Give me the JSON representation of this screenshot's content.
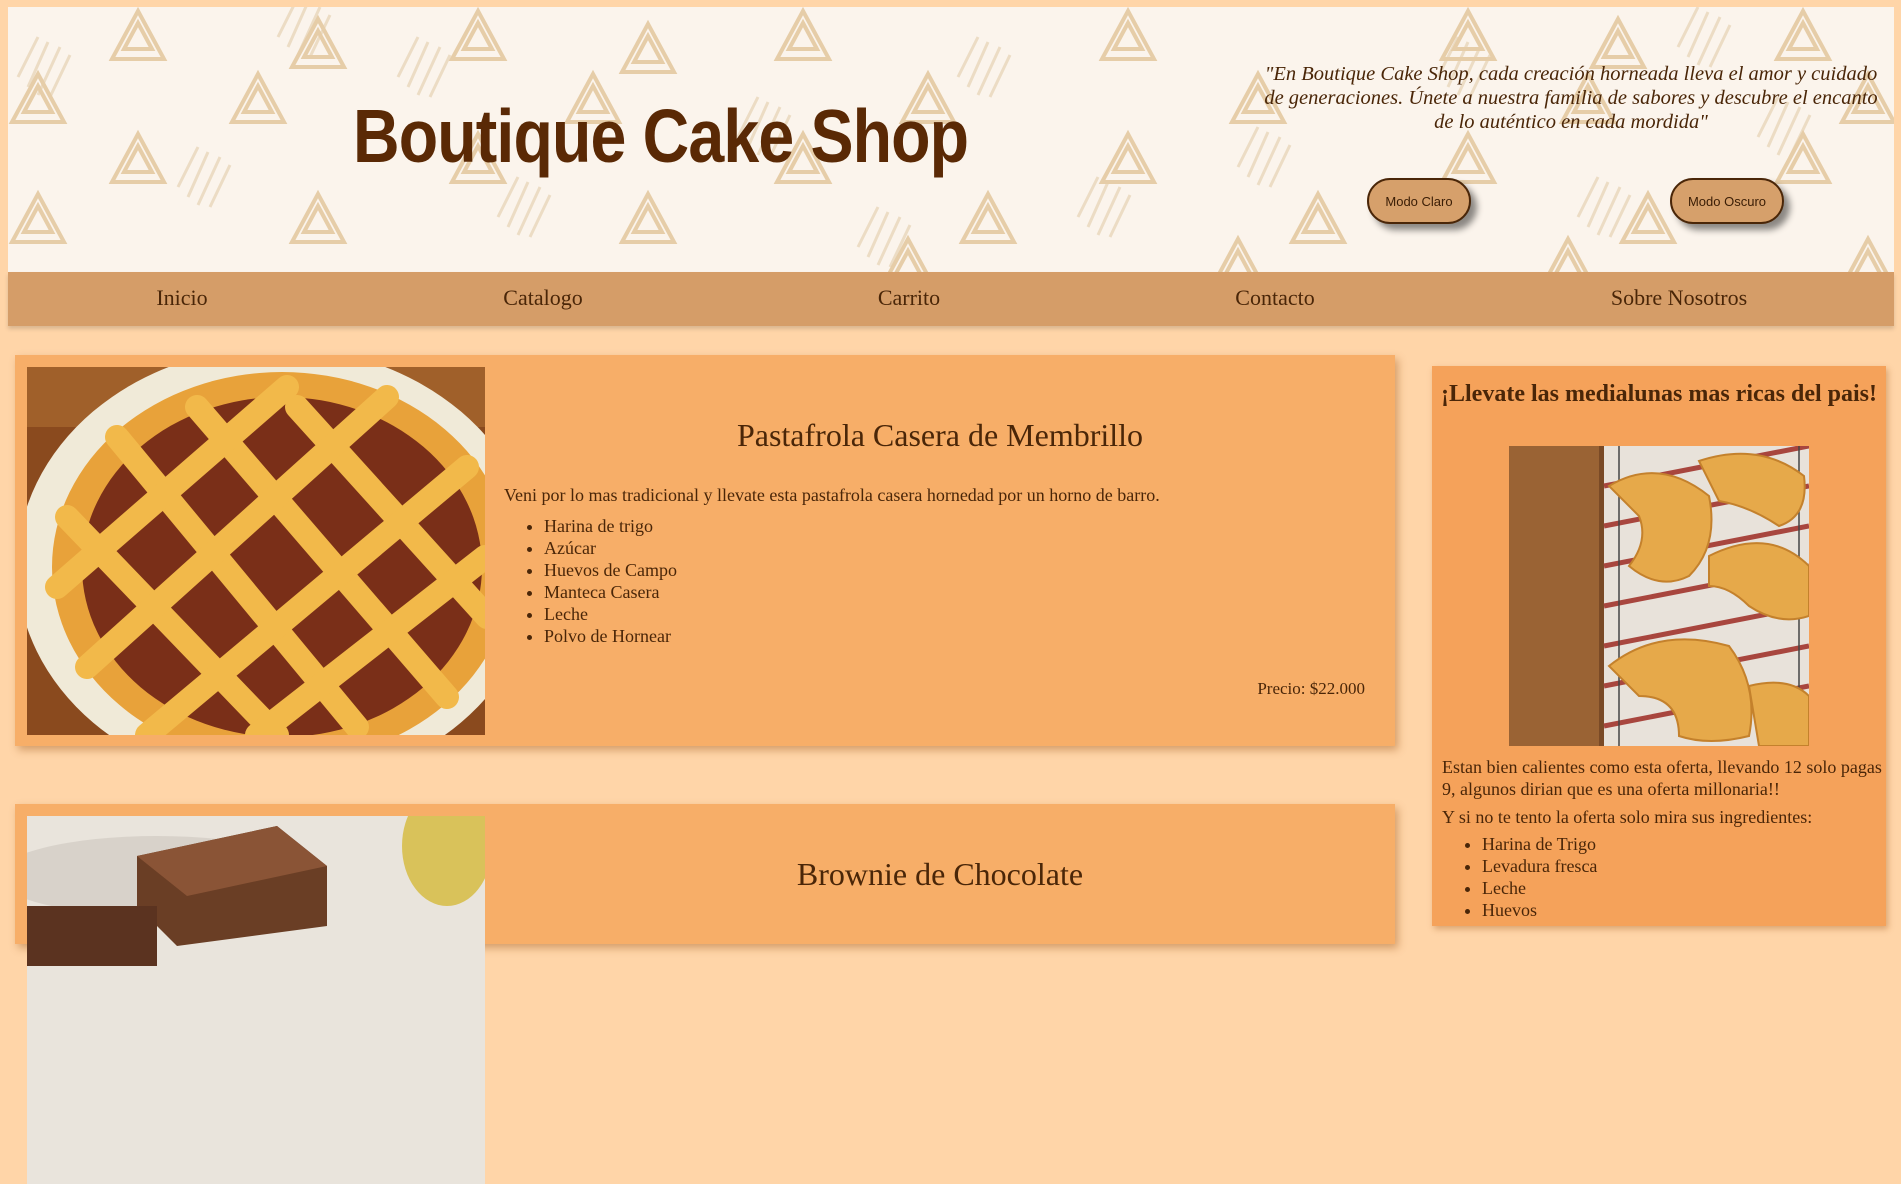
{
  "header": {
    "brand": "Boutique Cake Shop",
    "quote": "\"En Boutique Cake Shop, cada creación horneada lleva el amor y cuidado de generaciones. Únete a nuestra familia de sabores y descubre el encanto de lo auténtico en cada mordida\"",
    "btn_light": "Modo Claro",
    "btn_dark": "Modo Oscuro"
  },
  "nav": {
    "items": [
      {
        "label": "Inicio"
      },
      {
        "label": "Catalogo"
      },
      {
        "label": "Carrito"
      },
      {
        "label": "Contacto"
      },
      {
        "label": "Sobre Nosotros"
      }
    ]
  },
  "products": [
    {
      "title": "Pastafrola Casera de Membrillo",
      "description": "Veni por lo mas tradicional y llevate esta pastafrola casera hornedad por un horno de barro.",
      "ingredients": [
        "Harina de trigo",
        "Azúcar",
        "Huevos de Campo",
        "Manteca Casera",
        "Leche",
        "Polvo de Hornear"
      ],
      "price": "Precio: $22.000"
    },
    {
      "title": "Brownie de Chocolate"
    }
  ],
  "sidebar": {
    "title": "¡Llevate las medialunas mas ricas del pais!",
    "text1": "Estan bien calientes como esta oferta, llevando 12 solo pagas 9, algunos dirian que es una oferta millonaria!!",
    "text2": "Y si no te tento la oferta solo mira sus ingredientes:",
    "ingredients": [
      "Harina de Trigo",
      "Levadura fresca",
      "Leche",
      "Huevos"
    ]
  },
  "colors": {
    "page_bg": "#ffd5a8",
    "header_bg": "#fbf4ec",
    "nav_bg": "#d59d68",
    "card_bg": "#f7ae68",
    "sidebar_bg": "#f5a25a",
    "text": "#4a2608"
  }
}
